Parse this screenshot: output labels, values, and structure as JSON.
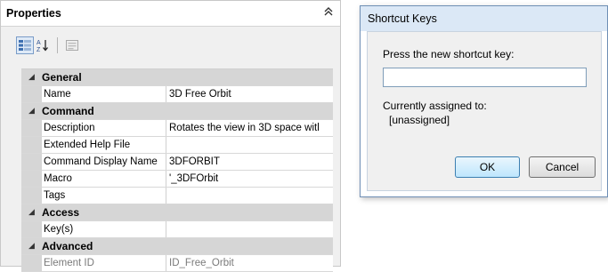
{
  "properties_panel": {
    "title": "Properties",
    "collapse_icon": "double-chevron-up-icon",
    "toolbar": [
      "categorized-view-icon",
      "sort-az-icon",
      "property-pages-icon"
    ],
    "categories": [
      {
        "label": "General",
        "rows": [
          {
            "name": "Name",
            "value": "3D Free Orbit"
          }
        ]
      },
      {
        "label": "Command",
        "rows": [
          {
            "name": "Description",
            "value": "Rotates the view in 3D space witl"
          },
          {
            "name": "Extended Help File",
            "value": ""
          },
          {
            "name": "Command Display Name",
            "value": "3DFORBIT"
          },
          {
            "name": "Macro",
            "value": "'_3DFOrbit"
          },
          {
            "name": "Tags",
            "value": ""
          }
        ]
      },
      {
        "label": "Access",
        "rows": [
          {
            "name": "Key(s)",
            "value": ""
          }
        ]
      },
      {
        "label": "Advanced",
        "rows": [
          {
            "name": "Element ID",
            "value": "ID_Free_Orbit",
            "dim": true
          }
        ]
      }
    ]
  },
  "dialog": {
    "title": "Shortcut Keys",
    "prompt": "Press the new shortcut key:",
    "input_value": "",
    "assigned_label": "Currently assigned to:",
    "assigned_value": "[unassigned]",
    "ok_label": "OK",
    "cancel_label": "Cancel"
  }
}
